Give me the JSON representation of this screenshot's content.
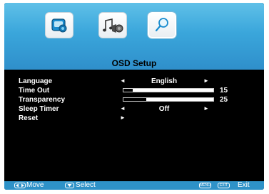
{
  "osd": {
    "title": "OSD Setup",
    "tabs": [
      {
        "name": "picture",
        "icon": "picture-icon"
      },
      {
        "name": "audio",
        "icon": "music-note-speaker-icon"
      },
      {
        "name": "osd",
        "icon": "magnifier-icon",
        "selected": true
      }
    ],
    "items": [
      {
        "label": "Language",
        "value": "English"
      },
      {
        "label": "Time Out",
        "value": "15",
        "level_percent": 10
      },
      {
        "label": "Transparency",
        "value": "25",
        "level_percent": 25
      },
      {
        "label": "Sleep Timer",
        "value": "Off"
      },
      {
        "label": "Reset"
      }
    ],
    "arrows": {
      "left": "◄",
      "right": "►"
    }
  },
  "footer": {
    "move_label": "Move",
    "select_label": "Select",
    "menu_key": "MENU",
    "exit_key": "EXIT",
    "exit_label": "Exit"
  },
  "colors": {
    "header_gradient_top": "#5fc0e8",
    "header_gradient_bottom": "#2f8fcb",
    "footer": "#2e92c8",
    "panel": "#000000",
    "text": "#ffffff"
  }
}
